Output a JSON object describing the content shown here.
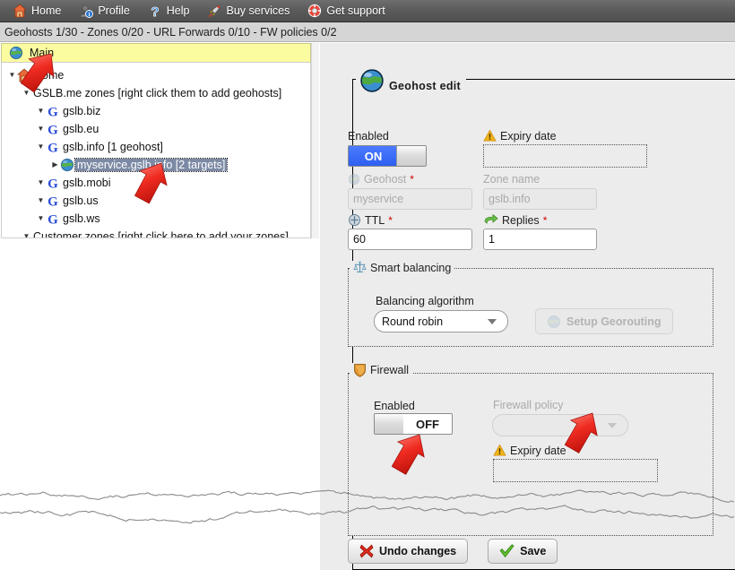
{
  "menubar": {
    "items": [
      {
        "label": "Home",
        "icon": "home-icon"
      },
      {
        "label": "Profile",
        "icon": "profile-icon"
      },
      {
        "label": "Help",
        "icon": "help-icon"
      },
      {
        "label": "Buy services",
        "icon": "rocket-icon"
      },
      {
        "label": "Get support",
        "icon": "lifebuoy-icon"
      }
    ],
    "background_color": "#5a5a5a",
    "text_color": "#ffffff"
  },
  "quota_bar": {
    "text": "Geohosts 1/30 - Zones 0/20 - URL Forwards 0/10 - FW policies 0/2",
    "background_color": "#d5d5d5"
  },
  "tree": {
    "header": {
      "label": "Main",
      "icon": "globe-icon",
      "background_color": "#fbfba0"
    },
    "selected_color": "#7c8aa5",
    "nodes": [
      {
        "label": "Home",
        "indent": 0,
        "twisty": "open",
        "icon": "house-icon",
        "selected": false
      },
      {
        "label": "GSLB.me zones [right click them to add geohosts]",
        "indent": 1,
        "twisty": "open",
        "icon": "none",
        "selected": false
      },
      {
        "label": "gslb.biz",
        "indent": 2,
        "twisty": "open",
        "icon": "g-icon",
        "selected": false
      },
      {
        "label": "gslb.eu",
        "indent": 2,
        "twisty": "open",
        "icon": "g-icon",
        "selected": false
      },
      {
        "label": "gslb.info [1 geohost]",
        "indent": 2,
        "twisty": "open",
        "icon": "g-icon",
        "selected": false
      },
      {
        "label": "myservice.gslb.info [2 targets]",
        "indent": 3,
        "twisty": "closed",
        "icon": "globe-icon",
        "selected": true
      },
      {
        "label": "gslb.mobi",
        "indent": 2,
        "twisty": "open",
        "icon": "g-icon",
        "selected": false
      },
      {
        "label": "gslb.us",
        "indent": 2,
        "twisty": "open",
        "icon": "g-icon",
        "selected": false
      },
      {
        "label": "gslb.ws",
        "indent": 2,
        "twisty": "open",
        "icon": "g-icon",
        "selected": false
      },
      {
        "label": "Customer zones [right click here to add your zones]",
        "indent": 1,
        "twisty": "open",
        "icon": "none",
        "selected": false
      }
    ]
  },
  "editor": {
    "legend": {
      "label": "Geohost edit",
      "icon": "globe-icon"
    },
    "enabled": {
      "label": "Enabled",
      "state": "ON",
      "on_color": "#2e5ff0"
    },
    "expiry_date": {
      "label": "Expiry date",
      "icon": "warning-icon",
      "value": "",
      "warning_color": "#f0a818"
    },
    "geohost": {
      "label": "Geohost",
      "required": "*",
      "value": "myservice",
      "icon": "globe-icon",
      "disabled": true
    },
    "zone_name": {
      "label": "Zone name",
      "value": "gslb.info",
      "disabled": true
    },
    "ttl": {
      "label": "TTL",
      "required": "*",
      "value": "60",
      "icon": "clock-icon"
    },
    "replies": {
      "label": "Replies",
      "required": "*",
      "value": "1",
      "icon": "green-arrow-icon"
    },
    "smart_balancing": {
      "legend": "Smart balancing",
      "icon": "scales-icon",
      "algorithm_label": "Balancing algorithm",
      "algorithm_value": "Round robin",
      "algorithm_options": [
        "Round robin"
      ],
      "georouting_button": {
        "label": "Setup Georouting",
        "icon": "globe-icon",
        "disabled": true
      }
    },
    "firewall": {
      "legend": "Firewall",
      "icon": "shield-icon",
      "enabled": {
        "label": "Enabled",
        "state": "OFF"
      },
      "policy": {
        "label": "Firewall policy",
        "value": "",
        "disabled": true
      },
      "expiry_date": {
        "label": "Expiry date",
        "icon": "warning-icon",
        "value": ""
      }
    }
  },
  "footer": {
    "undo_button": {
      "label": "Undo changes",
      "icon": "red-x-icon"
    },
    "save_button": {
      "label": "Save",
      "icon": "green-check-icon"
    }
  }
}
